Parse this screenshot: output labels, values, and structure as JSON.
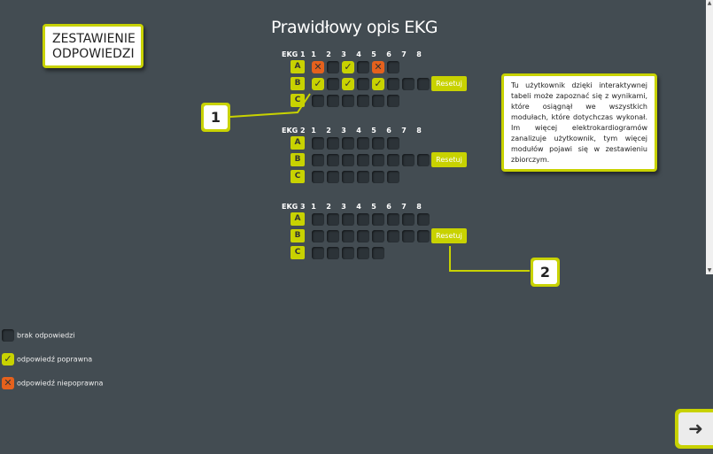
{
  "title": "Prawidłowy opis EKG",
  "summary_label": "ZESTAWIENIE ODPOWIEDZI",
  "reset_label": "Resetuj",
  "columns": [
    "1",
    "2",
    "3",
    "4",
    "5",
    "6",
    "7",
    "8"
  ],
  "ekgs": [
    {
      "label": "EKG 1",
      "rows": [
        {
          "label": "A",
          "cells": [
            "bad",
            "empty",
            "ok",
            "empty",
            "bad",
            "empty"
          ]
        },
        {
          "label": "B",
          "cells": [
            "ok",
            "empty",
            "ok",
            "empty",
            "ok",
            "empty",
            "empty",
            "empty"
          ]
        },
        {
          "label": "C",
          "cells": [
            "empty",
            "empty",
            "empty",
            "empty",
            "empty",
            "empty"
          ]
        }
      ]
    },
    {
      "label": "EKG 2",
      "rows": [
        {
          "label": "A",
          "cells": [
            "empty",
            "empty",
            "empty",
            "empty",
            "empty",
            "empty"
          ]
        },
        {
          "label": "B",
          "cells": [
            "empty",
            "empty",
            "empty",
            "empty",
            "empty",
            "empty",
            "empty",
            "empty"
          ]
        },
        {
          "label": "C",
          "cells": [
            "empty",
            "empty",
            "empty",
            "empty",
            "empty",
            "empty"
          ]
        }
      ]
    },
    {
      "label": "EKG 3",
      "rows": [
        {
          "label": "A",
          "cells": [
            "empty",
            "empty",
            "empty",
            "empty",
            "empty",
            "empty",
            "empty",
            "empty"
          ]
        },
        {
          "label": "B",
          "cells": [
            "empty",
            "empty",
            "empty",
            "empty",
            "empty",
            "empty",
            "empty",
            "empty"
          ]
        },
        {
          "label": "C",
          "cells": [
            "empty",
            "empty",
            "empty",
            "empty",
            "empty"
          ]
        }
      ]
    }
  ],
  "callouts": [
    "1",
    "2"
  ],
  "info_text": "Tu użytkownik dzięki interaktywnej tabeli może zapoznać się z wynikami, które osiągnął we wszystkich modułach, które dotychczas wykonał. Im więcej elektrokardiogramów zanalizuje użytkownik, tym więcej modułów pojawi się w zestawieniu zbiorczym.",
  "legend": [
    {
      "state": "empty",
      "label": "brak odpowiedzi"
    },
    {
      "state": "ok",
      "label": "odpowiedź poprawna"
    },
    {
      "state": "bad",
      "label": "odpowiedź niepoprawna"
    }
  ],
  "next_icon": "arrow-right-icon",
  "colors": {
    "accent": "#c8d200",
    "wrong": "#e5611d",
    "background": "#434c52",
    "empty_cell": "#2c3338"
  }
}
